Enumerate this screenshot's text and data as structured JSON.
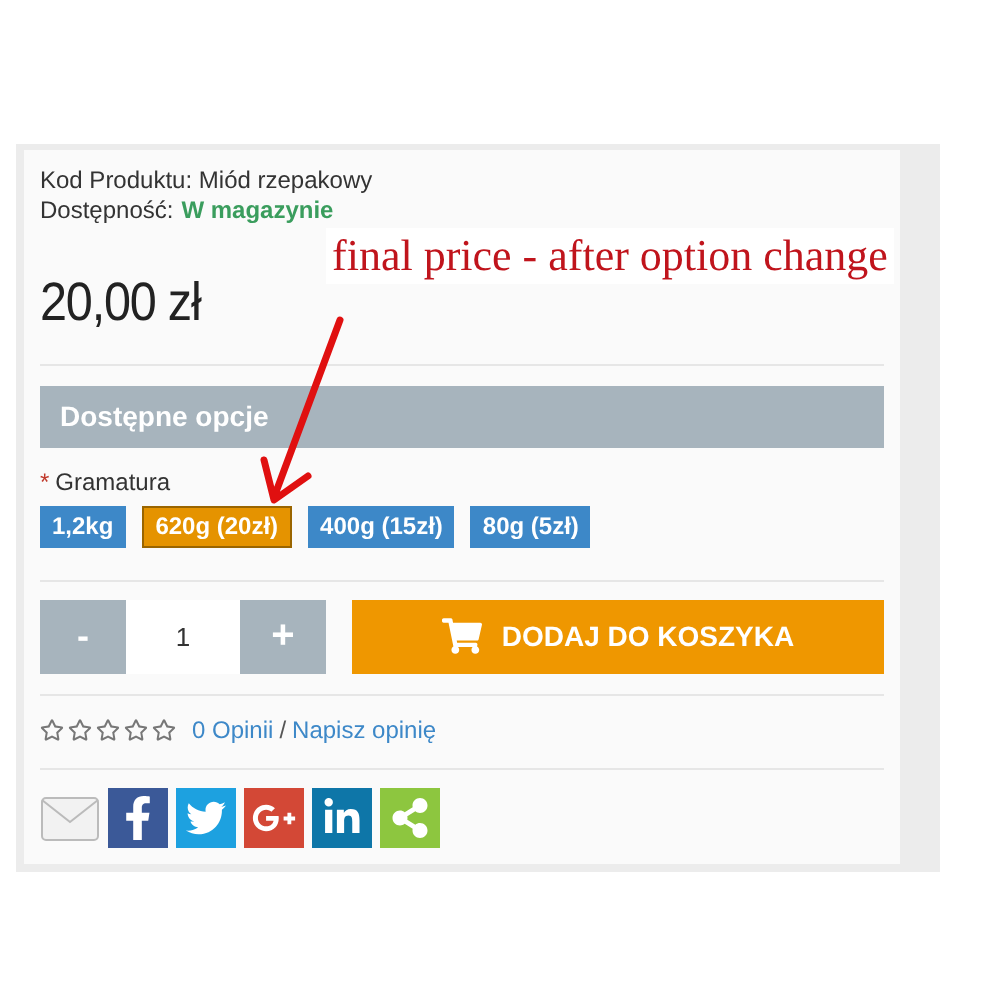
{
  "product": {
    "code_label": "Kod Produktu:",
    "code": "Miód rzepakowy",
    "availability_label": "Dostępność:",
    "availability": "W magazynie",
    "price": "20,00 zł"
  },
  "annotation": {
    "text": "final price - after option change"
  },
  "options": {
    "header": "Dostępne opcje",
    "required_mark": "*",
    "label": "Gramatura",
    "values": [
      {
        "label": "1,2kg",
        "selected": false
      },
      {
        "label": "620g (20zł)",
        "selected": true
      },
      {
        "label": "400g (15zł)",
        "selected": false
      },
      {
        "label": "80g (5zł)",
        "selected": false
      }
    ]
  },
  "cart": {
    "minus": "-",
    "quantity": "1",
    "plus": "+",
    "add_button": "DODAJ DO KOSZYKA"
  },
  "reviews": {
    "stars": 0,
    "count": "0 Opinii",
    "separator": "/",
    "write": "Napisz opinię"
  }
}
